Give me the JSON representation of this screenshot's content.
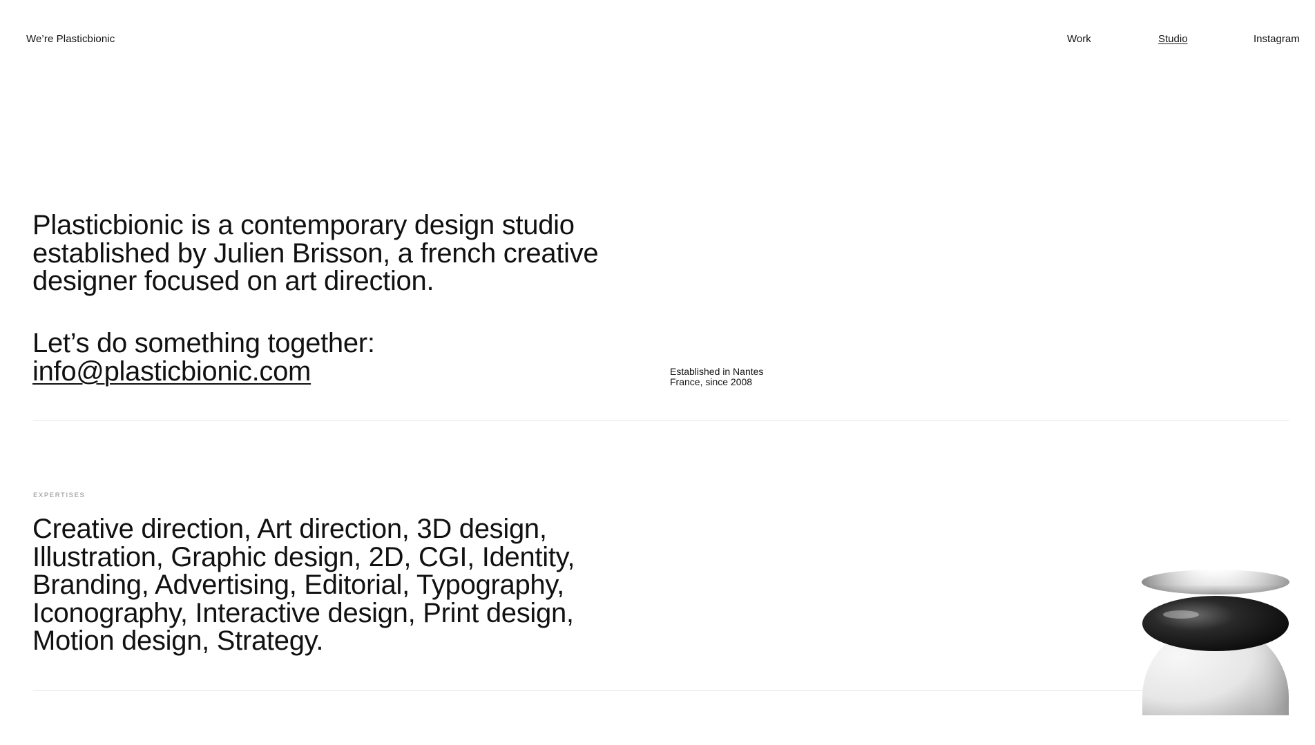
{
  "header": {
    "brand": "We’re Plasticbionic",
    "nav": {
      "work": "Work",
      "studio": "Studio",
      "instagram": "Instagram"
    }
  },
  "intro": {
    "text": "Plasticbionic is a contemporary design studio established by Julien Brisson, a french creative designer focused on art direction.",
    "cta_text": "Let’s do something together:",
    "email": "info@plasticbionic.com"
  },
  "established": {
    "line1": "Established in Nantes",
    "line2": "France, since 2008"
  },
  "expertises": {
    "label": "EXPERTISES",
    "text": "Creative direction, Art direction, 3D design, Illustration, Graphic design, 2D, CGI, Identity, Branding, Advertising, Editorial, Typography, Iconography, Interactive design, Print design, Motion design, Strategy."
  },
  "colors": {
    "text": "#111111",
    "background": "#ffffff",
    "divider": "#e4e4e4",
    "label": "#8a8a8a"
  }
}
